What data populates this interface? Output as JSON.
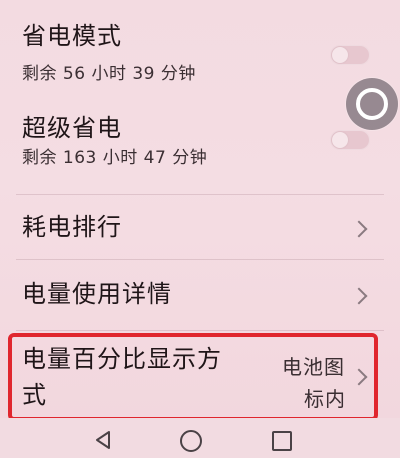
{
  "settings": {
    "power_saving": {
      "title": "省电模式",
      "remaining": "剩余 56 小时 39 分钟",
      "enabled": false
    },
    "ultra_power_saving": {
      "title": "超级省电",
      "remaining": "剩余 163 小时 47 分钟",
      "enabled": false
    },
    "power_ranking": {
      "title": "耗电排行"
    },
    "battery_usage_details": {
      "title": "电量使用详情"
    },
    "battery_percentage_display": {
      "title_line1": "电量百分比显示方",
      "title_line2": "式",
      "value_line1": "电池图",
      "value_line2": "标内"
    }
  },
  "highlight_color": "#e0262e"
}
